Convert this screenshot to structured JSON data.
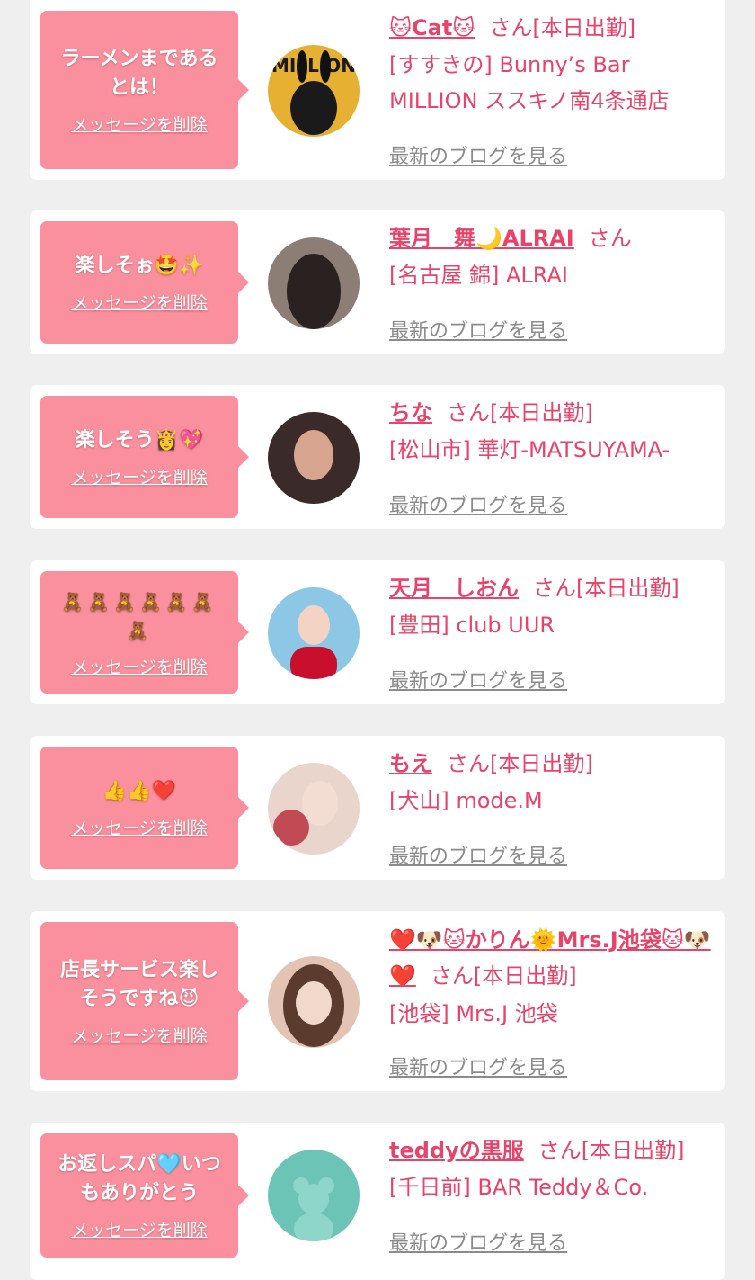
{
  "delete_label": "メッセージを削除",
  "blog_label": "最新のブログを見る",
  "items": [
    {
      "message": "ラーメンまであるとは！",
      "name": "🐱Cat🐱",
      "suffix": "さん[本日出勤]",
      "shop": "[すすきの] Bunny’s Bar MILLION ススキノ南4条通店",
      "avatar_colors": [
        "#e6b033",
        "#1a1a1a"
      ],
      "avatar_text": "MILLION"
    },
    {
      "message": "楽しそぉ🤩✨",
      "name": "葉月　舞🌙ALRAI",
      "suffix": "さん",
      "shop": "[名古屋 錦] ALRAI",
      "avatar_colors": [
        "#8c7d75",
        "#2a2220"
      ]
    },
    {
      "message": "楽しそう👸💖",
      "name": "ちな",
      "suffix": "さん[本日出勤]",
      "shop": "[松山市] 華灯-MATSUYAMA-",
      "avatar_colors": [
        "#d7a58f",
        "#3a2a2a"
      ]
    },
    {
      "message": "🧸🧸🧸🧸🧸🧸🧸",
      "name": "天月　しおん",
      "suffix": "さん[本日出勤]",
      "shop": "[豊田] club UUR",
      "avatar_colors": [
        "#8cc7e6",
        "#c8102e"
      ]
    },
    {
      "message": "👍👍❤️",
      "name": "もえ",
      "suffix": "さん[本日出勤]",
      "shop": "[犬山] mode.M",
      "avatar_colors": [
        "#e9d5cc",
        "#c24a55"
      ]
    },
    {
      "message": "店長サービス楽しそうですね😈",
      "name": "❤️🐶🐱かりん🌞Mrs.J池袋🐱🐶❤️",
      "suffix": "さん[本日出勤]",
      "shop": "[池袋] Mrs.J 池袋",
      "avatar_colors": [
        "#e3c3b3",
        "#5a3b2e"
      ]
    },
    {
      "message": "お返しスパ🩵いつもありがとう",
      "name": "teddyの黒服",
      "suffix": "さん[本日出勤]",
      "shop": "[千日前] BAR Teddy＆Co.",
      "avatar_colors": [
        "#6cc4b6",
        "#8ed6ca"
      ]
    }
  ]
}
